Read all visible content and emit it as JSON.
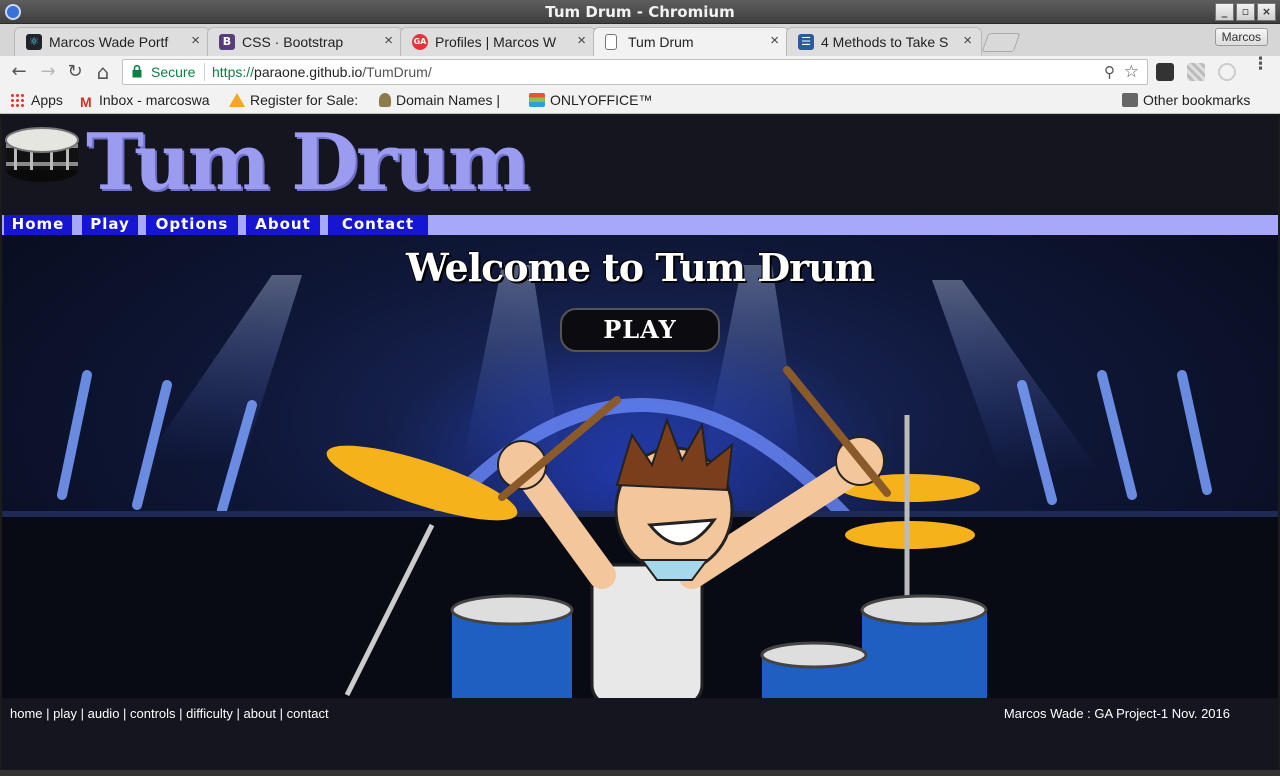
{
  "window": {
    "title": "Tum Drum - Chromium",
    "min": "_",
    "max": "▫",
    "close": "×"
  },
  "tabs": [
    {
      "title": "Marcos Wade Portf",
      "favicon": "react-icon",
      "color": "#20232a",
      "glyph": "⚛"
    },
    {
      "title": "CSS · Bootstrap",
      "favicon": "bootstrap-icon",
      "color": "#563d7c",
      "glyph": "B"
    },
    {
      "title": "Profiles | Marcos W",
      "favicon": "ga-icon",
      "color": "#e0373b",
      "glyph": "GA"
    },
    {
      "title": "Tum Drum",
      "favicon": "page-icon",
      "color": "#ffffff",
      "glyph": ""
    },
    {
      "title": "4 Methods to Take S",
      "favicon": "wikihow-icon",
      "color": "#2d5b9a",
      "glyph": "☰"
    }
  ],
  "tab_close": "×",
  "profile": "Marcos",
  "toolbar": {
    "back": "←",
    "forward": "→",
    "reload": "↻",
    "home": "⌂",
    "secure_label": "Secure",
    "url_scheme": "https://",
    "url_host": "paraone.github.io",
    "url_path": "/TumDrum/",
    "zoom_icon": "⚲",
    "star_icon": "☆",
    "menu_icon": "⋮"
  },
  "bookmarks": [
    {
      "label": "Apps",
      "icon": "apps-grid-icon"
    },
    {
      "label": "Inbox - marcoswa",
      "icon": "gmail-icon"
    },
    {
      "label": "Register for Sale:",
      "icon": "register-icon"
    },
    {
      "label": "Domain Names |",
      "icon": "domain-icon"
    },
    {
      "label": "ONLYOFFICE™",
      "icon": "onlyoffice-icon"
    }
  ],
  "other_bookmarks": "Other bookmarks",
  "site": {
    "title": "Tum Drum",
    "nav": [
      "Home",
      "Play",
      "Options",
      "About",
      "Contact"
    ],
    "welcome": "Welcome to Tum Drum",
    "play_button": "PLAY",
    "footer_links": [
      "home",
      "play",
      "audio",
      "controls",
      "difficulty",
      "about",
      "contact"
    ],
    "footer_credit": "Marcos Wade : GA Project-1 Nov. 2016"
  },
  "colors": {
    "accent": "#9b9cf0",
    "nav_bg": "#1515d2",
    "nav_strip": "#a8a8fb",
    "page_bg": "#14151f",
    "secure_green": "#0b8043"
  }
}
